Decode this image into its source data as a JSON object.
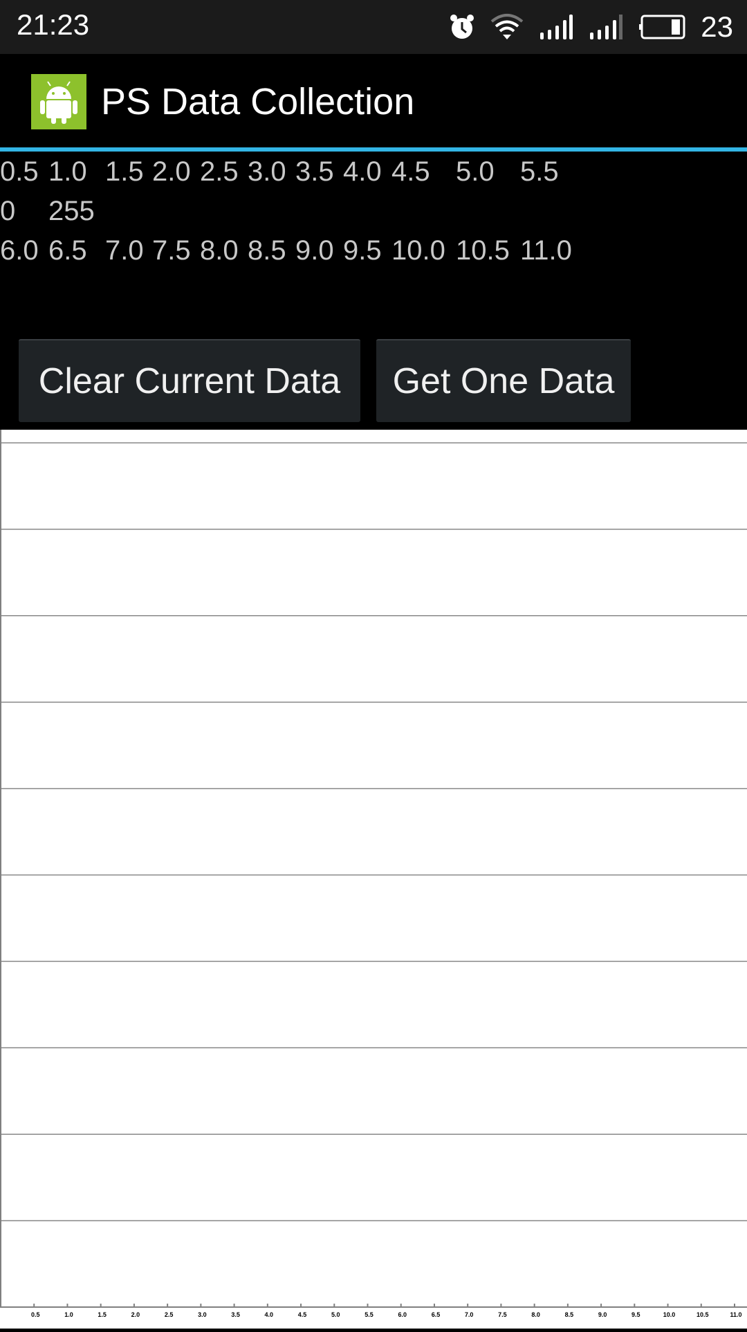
{
  "status_bar": {
    "time": "21:23",
    "battery_level": "23",
    "icons": [
      "alarm-icon",
      "wifi-icon",
      "signal-icon",
      "signal-icon",
      "battery-icon"
    ]
  },
  "app_bar": {
    "title": "PS Data Collection",
    "icon": "android-icon",
    "accent": "#33b5e5"
  },
  "readout": {
    "row1": [
      "0.5",
      "1.0",
      "1.5",
      "2.0",
      "2.5",
      "3.0",
      "3.5",
      "4.0",
      "4.5",
      "5.0",
      "5.5"
    ],
    "row2": [
      "0",
      "255"
    ],
    "row3": [
      "6.0",
      "6.5",
      "7.0",
      "7.5",
      "8.0",
      "8.5",
      "9.0",
      "9.5",
      "10.0",
      "10.5",
      "11.0"
    ]
  },
  "buttons": {
    "clear": "Clear Current Data",
    "get_one": "Get One Data"
  },
  "chart_data": {
    "type": "line",
    "series": [],
    "x_ticks": [
      "0.5",
      "1.0",
      "1.5",
      "2.0",
      "2.5",
      "3.0",
      "3.5",
      "4.0",
      "4.5",
      "5.0",
      "5.5",
      "6.0",
      "6.5",
      "7.0",
      "7.5",
      "8.0",
      "8.5",
      "9.0",
      "9.5",
      "10.0",
      "10.5",
      "11.0"
    ],
    "xlim": [
      0,
      11
    ],
    "horizontal_gridlines": 10,
    "grid": true
  }
}
